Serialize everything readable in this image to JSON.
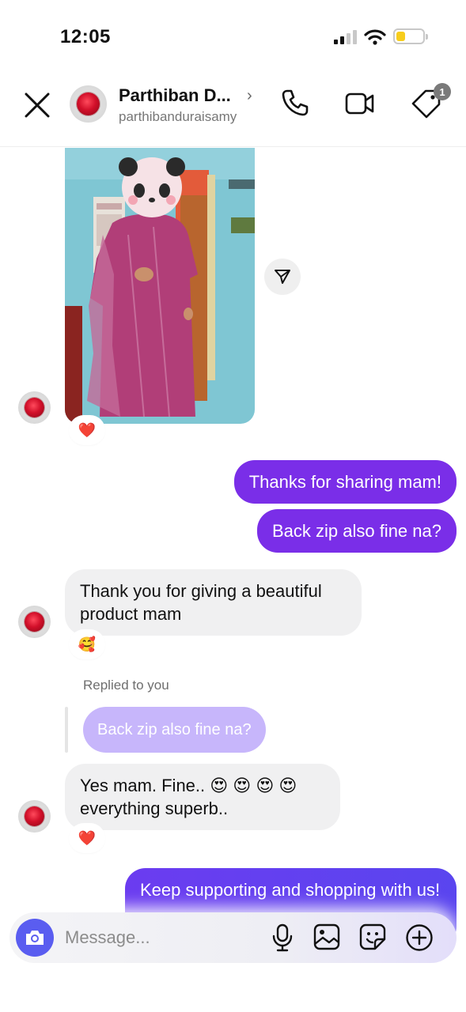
{
  "status_bar": {
    "time": "12:05"
  },
  "header": {
    "contact_name": "Parthiban D...",
    "username": "parthibanduraisamy",
    "chevron": "›",
    "badge_count": "1"
  },
  "messages": {
    "outgoing_1": "Thanks for sharing mam!",
    "outgoing_2": "Back zip also fine na?",
    "incoming_1": "Thank you for giving a beautiful product mam",
    "reaction_photo": "❤️",
    "reaction_incoming_1": "🥰",
    "replied_label": "Replied to you",
    "quoted_text": "Back zip also fine na?",
    "incoming_2": "Yes mam. Fine.. 😍 😍 😍 😍 everything superb..",
    "reaction_incoming_2": "❤️",
    "outgoing_3": "Keep supporting and shopping with us!"
  },
  "composer": {
    "placeholder": "Message..."
  },
  "colors": {
    "outgoing_bubble": "#7a2ee8",
    "incoming_bubble": "#f0f0f1",
    "quoted_bubble": "#c7b6fb",
    "camera_button": "#5a5df0"
  },
  "icons": [
    "close-icon",
    "phone-icon",
    "video-icon",
    "tag-icon",
    "share-icon",
    "camera-icon",
    "microphone-icon",
    "gallery-icon",
    "sticker-icon",
    "plus-circle-icon"
  ]
}
